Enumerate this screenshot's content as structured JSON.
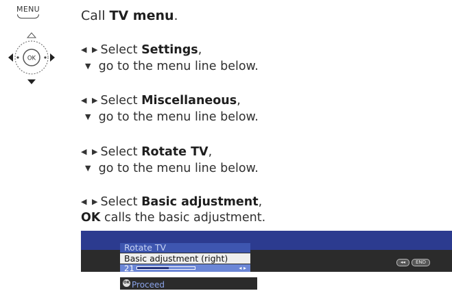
{
  "menu_key": {
    "label": "MENU"
  },
  "navpad": {
    "center_label": "OK"
  },
  "intro": {
    "prefix": "Call ",
    "bold": "TV menu",
    "suffix": "."
  },
  "steps": [
    {
      "prefix": "Select ",
      "bold": "Settings",
      "suffix": ",",
      "line2": "go to the menu line below."
    },
    {
      "prefix": "Select ",
      "bold": "Miscellaneous",
      "suffix": ",",
      "line2": "go to the menu line below."
    },
    {
      "prefix": "Select ",
      "bold": "Rotate TV",
      "suffix": ",",
      "line2": "go to the menu line below."
    },
    {
      "prefix": "Select ",
      "bold": "Basic adjustment",
      "suffix": ",",
      "ok_key": "OK",
      "line2": "calls the basic adjustment."
    }
  ],
  "tv_screen": {
    "menu_title": "Rotate TV",
    "item": "Basic adjustment (right)",
    "value": "21",
    "slider_fraction": 0.55,
    "proceed": "Proceed",
    "proceed_key": "OK",
    "buttons": [
      "◂◂",
      "END"
    ],
    "colors": {
      "top_bar": "#2c3b8f",
      "panel": "#2b2b2b",
      "value_row": "#6b86d6"
    }
  }
}
